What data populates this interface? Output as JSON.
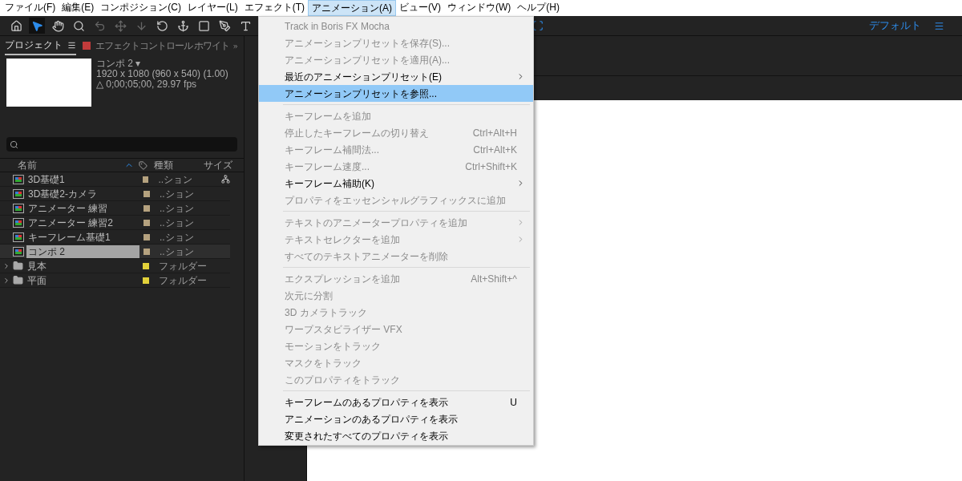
{
  "menu_bar": [
    {
      "label": "ファイル(F)",
      "selected": false
    },
    {
      "label": "編集(E)",
      "selected": false
    },
    {
      "label": "コンポジション(C)",
      "selected": false
    },
    {
      "label": "レイヤー(L)",
      "selected": false
    },
    {
      "label": "エフェクト(T)",
      "selected": false
    },
    {
      "label": "アニメーション(A)",
      "selected": true
    },
    {
      "label": "ビュー(V)",
      "selected": false
    },
    {
      "label": "ウィンドウ(W)",
      "selected": false
    },
    {
      "label": "ヘルプ(H)",
      "selected": false
    }
  ],
  "toolbar": {
    "tools": [
      {
        "kind": "home",
        "selected": false
      },
      {
        "kind": "select",
        "selected": true
      },
      {
        "kind": "hand",
        "selected": false
      },
      {
        "kind": "zoom",
        "selected": false
      },
      {
        "kind": "orbit",
        "selected": false
      },
      {
        "kind": "pan",
        "selected": false
      },
      {
        "kind": "dolly",
        "selected": false
      },
      {
        "kind": "rotate",
        "selected": false
      },
      {
        "kind": "anchor",
        "selected": false
      },
      {
        "kind": "shape",
        "selected": false
      },
      {
        "kind": "pen",
        "selected": false
      },
      {
        "kind": "text",
        "selected": false
      }
    ],
    "workspace": "デフォルト"
  },
  "project_panel": {
    "tabs": [
      {
        "label": "プロジェクト",
        "selected": true,
        "kind": "project"
      },
      {
        "label": "エフェクトコントロール ホワイト",
        "selected": false,
        "kind": "effects"
      }
    ],
    "comp_info": [
      "コンポ 2 ▾",
      "1920 x 1080  (960 x 540) (1.00)",
      "△ 0;00;05;00, 29.97 fps"
    ],
    "columns": [
      "名前",
      "種類",
      "サイズ"
    ],
    "rows": [
      {
        "name": "3D基礎1",
        "type": "..ション",
        "kind": "comp",
        "color": "#b5a27f",
        "selected": false
      },
      {
        "name": "3D基礎2-カメラ",
        "type": "..ション",
        "kind": "comp",
        "color": "#b5a27f",
        "selected": false
      },
      {
        "name": "アニメーター 練習",
        "type": "..ション",
        "kind": "comp",
        "color": "#b5a27f",
        "selected": false
      },
      {
        "name": "アニメーター 練習2",
        "type": "..ション",
        "kind": "comp",
        "color": "#b5a27f",
        "selected": false
      },
      {
        "name": "キーフレーム基礎1",
        "type": "..ション",
        "kind": "comp",
        "color": "#b5a27f",
        "selected": false
      },
      {
        "name": "コンポ 2",
        "type": "..ション",
        "kind": "comp",
        "color": "#b5a27f",
        "selected": true
      },
      {
        "name": "見本",
        "type": "フォルダー",
        "kind": "folder",
        "color": "#e2d13a",
        "selected": false
      },
      {
        "name": "平面",
        "type": "フォルダー",
        "kind": "folder",
        "color": "#e2d13a",
        "selected": false
      }
    ]
  },
  "animation_menu": [
    {
      "kind": "item",
      "label": "Track in Boris FX Mocha",
      "disabled": true,
      "submenu": false,
      "selected": false
    },
    {
      "kind": "item",
      "label": "アニメーションプリセットを保存(S)...",
      "disabled": true,
      "submenu": false,
      "selected": false
    },
    {
      "kind": "item",
      "label": "アニメーションプリセットを適用(A)...",
      "disabled": true,
      "submenu": false,
      "selected": false
    },
    {
      "kind": "item",
      "label": "最近のアニメーションプリセット(E)",
      "disabled": false,
      "submenu": true,
      "selected": false
    },
    {
      "kind": "item",
      "label": "アニメーションプリセットを参照...",
      "disabled": false,
      "submenu": false,
      "selected": true
    },
    {
      "kind": "separator"
    },
    {
      "kind": "item",
      "label": "キーフレームを追加",
      "disabled": true,
      "submenu": false,
      "selected": false
    },
    {
      "kind": "item",
      "label": "停止したキーフレームの切り替え",
      "shortcut": "Ctrl+Alt+H",
      "disabled": true,
      "submenu": false,
      "selected": false
    },
    {
      "kind": "item",
      "label": "キーフレーム補間法...",
      "shortcut": "Ctrl+Alt+K",
      "disabled": true,
      "submenu": false,
      "selected": false
    },
    {
      "kind": "item",
      "label": "キーフレーム速度...",
      "shortcut": "Ctrl+Shift+K",
      "disabled": true,
      "submenu": false,
      "selected": false
    },
    {
      "kind": "item",
      "label": "キーフレーム補助(K)",
      "disabled": false,
      "submenu": true,
      "selected": false
    },
    {
      "kind": "item",
      "label": "プロパティをエッセンシャルグラフィックスに追加",
      "disabled": true,
      "submenu": false,
      "selected": false
    },
    {
      "kind": "separator"
    },
    {
      "kind": "item",
      "label": "テキストのアニメータープロパティを追加",
      "disabled": true,
      "submenu": true,
      "selected": false
    },
    {
      "kind": "item",
      "label": "テキストセレクターを追加",
      "disabled": true,
      "submenu": true,
      "selected": false
    },
    {
      "kind": "item",
      "label": "すべてのテキストアニメーターを削除",
      "disabled": true,
      "submenu": false,
      "selected": false
    },
    {
      "kind": "separator"
    },
    {
      "kind": "item",
      "label": "エクスプレッションを追加",
      "shortcut": "Alt+Shift+^",
      "disabled": true,
      "submenu": false,
      "selected": false
    },
    {
      "kind": "item",
      "label": "次元に分割",
      "disabled": true,
      "submenu": false,
      "selected": false
    },
    {
      "kind": "item",
      "label": "3D カメラトラック",
      "disabled": true,
      "submenu": false,
      "selected": false
    },
    {
      "kind": "item",
      "label": "ワープスタビライザー VFX",
      "disabled": true,
      "submenu": false,
      "selected": false
    },
    {
      "kind": "item",
      "label": "モーションをトラック",
      "disabled": true,
      "submenu": false,
      "selected": false
    },
    {
      "kind": "item",
      "label": "マスクをトラック",
      "disabled": true,
      "submenu": false,
      "selected": false
    },
    {
      "kind": "item",
      "label": "このプロパティをトラック",
      "disabled": true,
      "submenu": false,
      "selected": false
    },
    {
      "kind": "separator"
    },
    {
      "kind": "item",
      "label": "キーフレームのあるプロパティを表示",
      "shortcut": "U",
      "disabled": false,
      "submenu": false,
      "selected": false
    },
    {
      "kind": "item",
      "label": "アニメーションのあるプロパティを表示",
      "disabled": false,
      "submenu": false,
      "selected": false
    },
    {
      "kind": "item",
      "label": "変更されたすべてのプロパティを表示",
      "disabled": false,
      "submenu": false,
      "selected": false
    }
  ]
}
